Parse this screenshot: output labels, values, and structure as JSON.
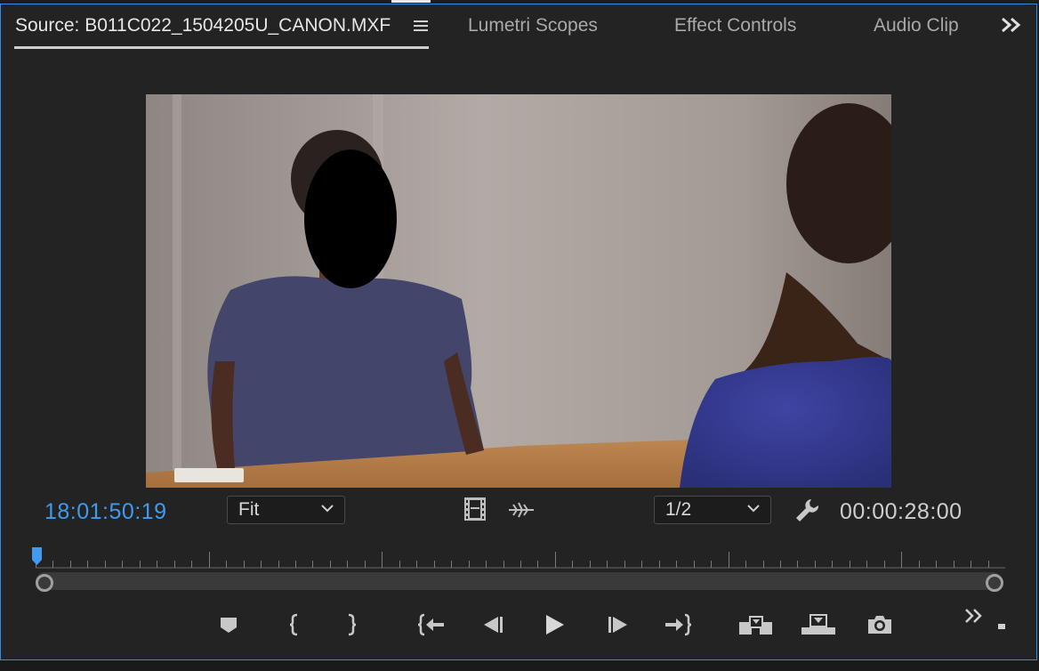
{
  "tabs": {
    "source": "Source: B011C022_1504205U_CANON.MXF",
    "lumetri": "Lumetri Scopes",
    "effects": "Effect Controls",
    "audio": "Audio Clip Mixer"
  },
  "monitor": {
    "current_timecode": "18:01:50:19",
    "zoom_value": "Fit",
    "resolution_value": "1/2",
    "duration_timecode": "00:00:28:00"
  },
  "icons": {
    "panel_menu": "hamburger-icon",
    "overflow": "double-chevron-right-icon",
    "drag_video": "film-strip-icon",
    "drag_audio": "waveform-icon",
    "settings": "wrench-icon",
    "add_marker": "marker-icon",
    "mark_in": "mark-in-icon",
    "mark_out": "mark-out-icon",
    "go_to_in": "go-to-in-icon",
    "step_back": "step-back-icon",
    "play": "play-icon",
    "step_forward": "step-forward-icon",
    "go_to_out": "go-to-out-icon",
    "insert": "insert-icon",
    "overwrite": "overwrite-icon",
    "export_frame": "camera-icon"
  },
  "colors": {
    "accent": "#3f9bf0",
    "panel_border": "#2f8ee8",
    "panel_bg": "#232323"
  }
}
